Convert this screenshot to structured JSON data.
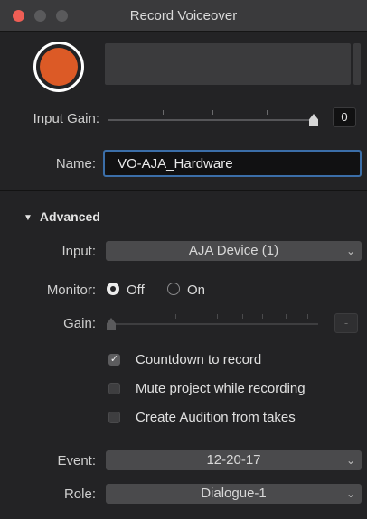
{
  "window": {
    "title": "Record Voiceover"
  },
  "input_gain": {
    "label": "Input Gain:",
    "value": "0",
    "level": 1.0
  },
  "name": {
    "label": "Name:",
    "value": "VO-AJA_Hardware"
  },
  "advanced": {
    "label": "Advanced",
    "input": {
      "label": "Input:",
      "value": "AJA Device (1)"
    },
    "monitor": {
      "label": "Monitor:",
      "off_label": "Off",
      "on_label": "On",
      "selected": "Off"
    },
    "gain": {
      "label": "Gain:",
      "value": "-",
      "level": 0.0
    },
    "options": [
      {
        "label": "Countdown to record",
        "checked": true
      },
      {
        "label": "Mute project while recording",
        "checked": false
      },
      {
        "label": "Create Audition from takes",
        "checked": false
      }
    ]
  },
  "event": {
    "label": "Event:",
    "value": "12-20-17"
  },
  "role": {
    "label": "Role:",
    "value": "Dialogue-1"
  },
  "icons": {
    "disclosure": "disclosure-triangle-icon",
    "chevron": "chevron-down-icon",
    "check": "checkmark-icon"
  },
  "colors": {
    "record": "#dc5a26",
    "focus_ring": "#3b6ea8",
    "close": "#ee5e55"
  }
}
